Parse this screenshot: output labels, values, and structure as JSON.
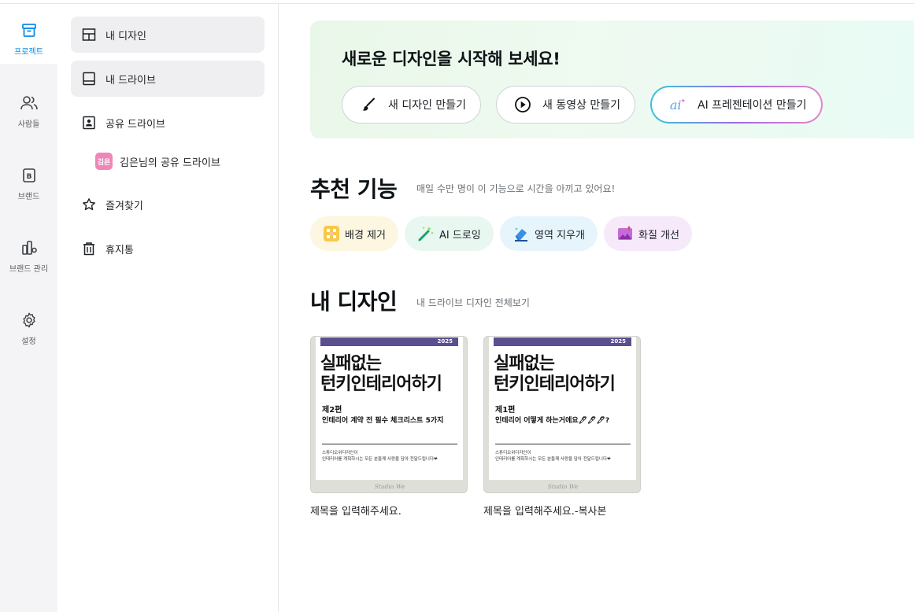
{
  "rail": {
    "items": [
      {
        "label": "프로젝트",
        "icon": "project-box-icon",
        "active": true
      },
      {
        "label": "사람들",
        "icon": "people-icon"
      },
      {
        "label": "브랜드",
        "icon": "brand-icon"
      },
      {
        "label": "브랜드 관리",
        "icon": "brand-manage-icon"
      },
      {
        "label": "설정",
        "icon": "gear-icon"
      }
    ]
  },
  "panel": {
    "items": [
      {
        "label": "내 디자인",
        "icon": "grid-icon"
      },
      {
        "label": "내 드라이브",
        "icon": "drive-icon"
      },
      {
        "label": "공유 드라이브",
        "icon": "shared-drive-icon"
      },
      {
        "label": "즐겨찾기",
        "icon": "star-icon"
      },
      {
        "label": "휴지통",
        "icon": "trash-icon"
      }
    ],
    "shared": {
      "avatar": "김은",
      "label": "김은님의 공유 드라이브"
    }
  },
  "hero": {
    "title": "새로운 디자인을 시작해 보세요!",
    "buttons": [
      {
        "label": "새 디자인 만들기",
        "icon": "brush-icon"
      },
      {
        "label": "새 동영상 만들기",
        "icon": "play-icon"
      },
      {
        "label": "AI 프레젠테이션 만들기",
        "icon": "ai-icon"
      }
    ]
  },
  "recommended": {
    "title": "추천 기능",
    "subtitle": "매일 수만 명이 이 기능으로 시간을 아끼고 있어요!",
    "chips": [
      {
        "label": "배경 제거",
        "icon": "background-remove-icon",
        "bg": "#fdf7e1"
      },
      {
        "label": "AI 드로잉",
        "icon": "magic-wand-icon",
        "bg": "#e8f7f0"
      },
      {
        "label": "영역 지우개",
        "icon": "eraser-icon",
        "bg": "#e5f5fb"
      },
      {
        "label": "화질 개선",
        "icon": "image-enhance-icon",
        "bg": "#f5e9fa"
      }
    ]
  },
  "designs": {
    "title": "내 디자인",
    "subtitle": "내 드라이브 디자인 전체보기",
    "cards": [
      {
        "year": "2025",
        "title_line1": "실패없는",
        "title_line2": "턴키인테리어하기",
        "episode": "제2편",
        "desc": "인테리어 계약 전 필수 체크리스트 5가지",
        "foot1": "스튜디오위디자인이",
        "foot2": "인테리어를 계획하시는 모든 분들께 사랑을 담아 전달드립니다❤",
        "brand": "Studio We",
        "name": "제목을 입력해주세요."
      },
      {
        "year": "2025",
        "title_line1": "실패없는",
        "title_line2": "턴키인테리어하기",
        "episode": "제1편",
        "desc": "인테리어 어떻게 하는거에요🖊🖊🖊?",
        "foot1": "스튜디오위디자인이",
        "foot2": "인테리어를 계획하시는 모든 분들께 사랑을 담아 전달드립니다❤",
        "brand": "Studio We",
        "name": "제목을 입력해주세요.-복사본"
      }
    ]
  },
  "colors": {
    "accent": "#0c8ce9",
    "cover_bar": "#5b4f8f",
    "avatar": "#ef86b8"
  }
}
